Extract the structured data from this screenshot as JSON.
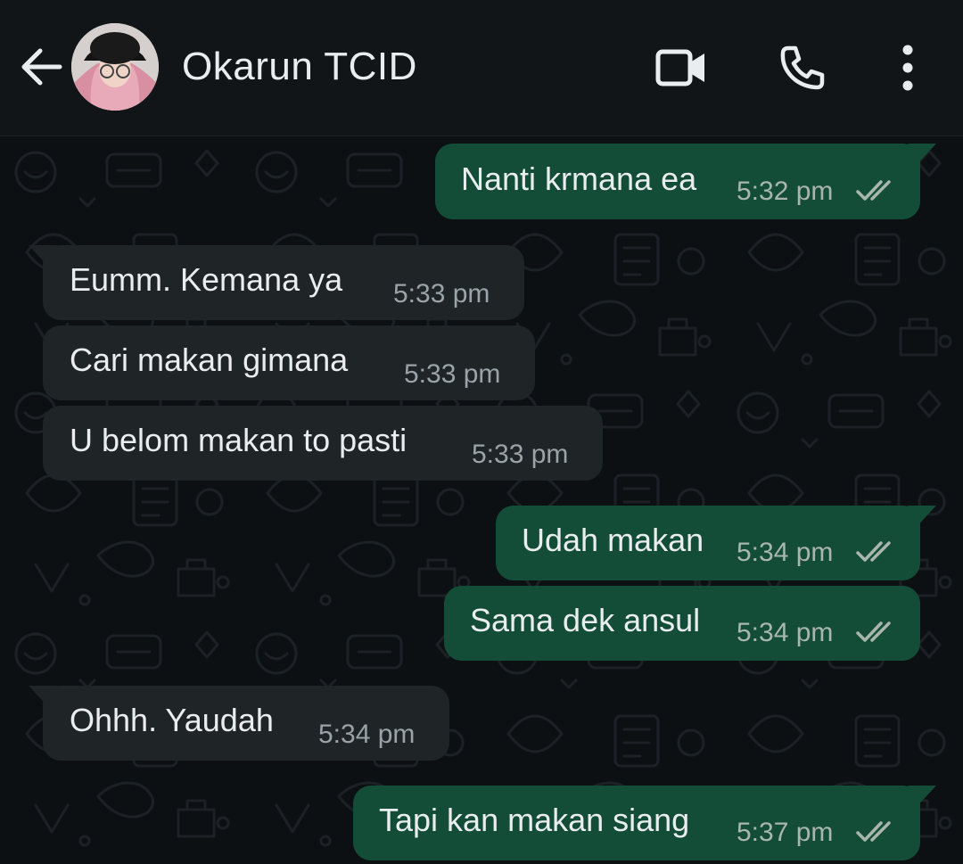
{
  "header": {
    "title": "Okarun TCID",
    "back_icon": "arrow-left-icon",
    "video_icon": "video-call-icon",
    "call_icon": "phone-icon",
    "menu_icon": "more-vertical-icon"
  },
  "colors": {
    "header_bg": "#111518",
    "chat_bg": "#0c1013",
    "outgoing_bubble": "#144d37",
    "incoming_bubble": "#1f2426",
    "text": "#e9edef",
    "time": "#a8b6ae"
  },
  "messages": [
    {
      "direction": "out",
      "text": "Nanti krmana ea",
      "time": "5:32 pm",
      "status": "double-check-icon"
    },
    {
      "direction": "in",
      "text": "Eumm. Kemana ya",
      "time": "5:33 pm"
    },
    {
      "direction": "in",
      "text": "Cari makan gimana",
      "time": "5:33 pm"
    },
    {
      "direction": "in",
      "text": "U belom makan to pasti",
      "time": "5:33 pm"
    },
    {
      "direction": "out",
      "text": "Udah makan",
      "time": "5:34 pm",
      "status": "double-check-icon"
    },
    {
      "direction": "out",
      "text": "Sama dek ansul",
      "time": "5:34 pm",
      "status": "double-check-icon"
    },
    {
      "direction": "in",
      "text": "Ohhh. Yaudah",
      "time": "5:34 pm"
    },
    {
      "direction": "out",
      "text": "Tapi kan makan siang",
      "time": "5:37 pm",
      "status": "double-check-icon"
    }
  ]
}
